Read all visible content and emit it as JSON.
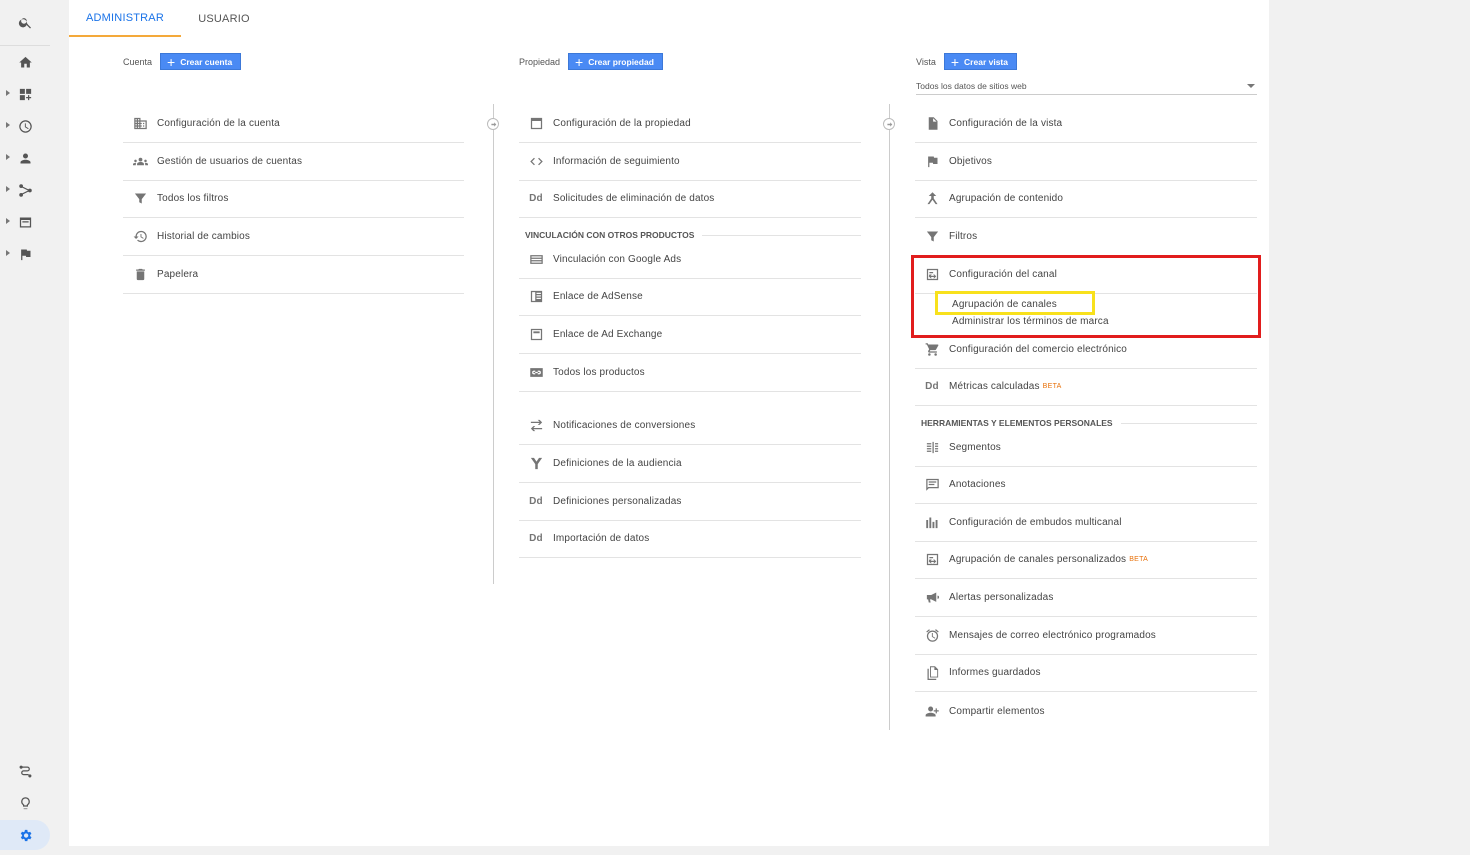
{
  "tabs": {
    "admin": "ADMINISTRAR",
    "user": "USUARIO"
  },
  "account": {
    "label": "Cuenta",
    "create": "Crear cuenta",
    "items": [
      "Configuración de la cuenta",
      "Gestión de usuarios de cuentas",
      "Todos los filtros",
      "Historial de cambios",
      "Papelera"
    ]
  },
  "property": {
    "label": "Propiedad",
    "create": "Crear propiedad",
    "items": [
      "Configuración de la propiedad",
      "Información de seguimiento",
      "Solicitudes de eliminación de datos"
    ],
    "section": "VINCULACIÓN CON OTROS PRODUCTOS",
    "link_items": [
      "Vinculación con Google Ads",
      "Enlace de AdSense",
      "Enlace de Ad Exchange",
      "Todos los productos"
    ],
    "more_items": [
      "Notificaciones de conversiones",
      "Definiciones de la audiencia",
      "Definiciones personalizadas",
      "Importación de datos"
    ]
  },
  "view": {
    "label": "Vista",
    "create": "Crear vista",
    "selected": "Todos los datos de sitios web",
    "items": [
      "Configuración de la vista",
      "Objetivos",
      "Agrupación de contenido",
      "Filtros",
      "Configuración del canal"
    ],
    "channel_sub": [
      "Agrupación de canales",
      "Administrar los términos de marca"
    ],
    "items2": [
      "Configuración del comercio electrónico",
      "Métricas calculadas"
    ],
    "beta": "BETA",
    "section": "HERRAMIENTAS Y ELEMENTOS PERSONALES",
    "tools": [
      "Segmentos",
      "Anotaciones",
      "Configuración de embudos multicanal",
      "Agrupación de canales personalizados",
      "Alertas personalizadas",
      "Mensajes de correo electrónico programados",
      "Informes guardados",
      "Compartir elementos"
    ]
  },
  "dd_icon": "Dd",
  "colors": {
    "accent": "#1a73e8",
    "button": "#4a8af4",
    "highlight_red": "#e11d1d",
    "highlight_yellow": "#f8e11c",
    "tab_underline": "#f4a93a"
  }
}
